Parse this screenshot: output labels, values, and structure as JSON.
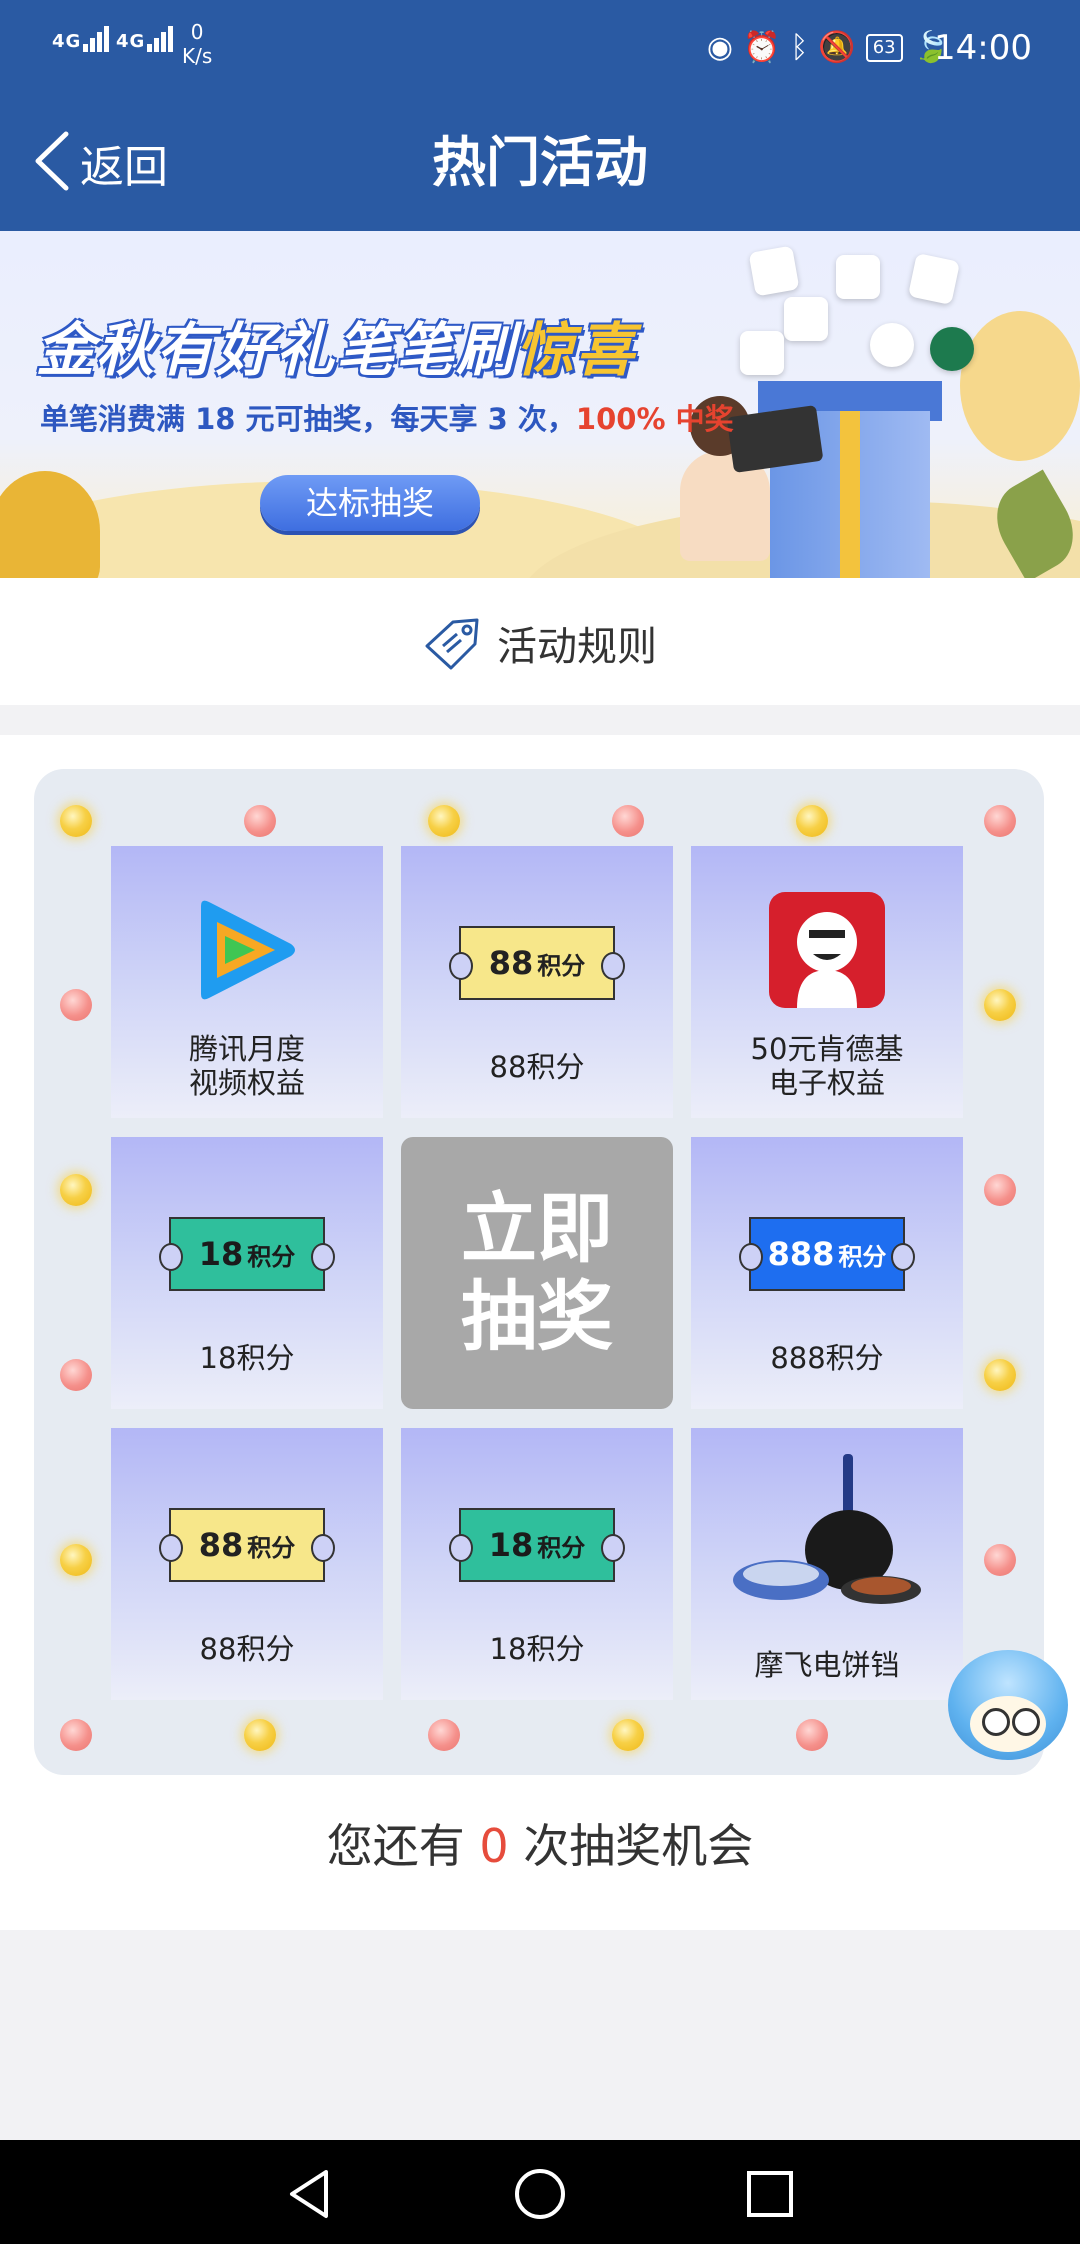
{
  "status_bar": {
    "sig1": "4G",
    "sig2": "4G",
    "net_speed": "0",
    "net_unit": "K/s",
    "battery": "63",
    "time": "14:00"
  },
  "nav": {
    "back_label": "返回",
    "title": "热门活动"
  },
  "banner": {
    "title_main": "金秋有好礼笔笔刷",
    "title_highlight": "惊喜",
    "subtitle_main": "单笔消费满 18 元可抽奖，每天享 3 次，",
    "subtitle_highlight": "100% 中奖",
    "button_label": "达标抽奖"
  },
  "rules": {
    "label": "活动规则"
  },
  "grid": {
    "cells": [
      {
        "label_line1": "腾讯月度",
        "label_line2": "视频权益"
      },
      {
        "ticket_num": "88",
        "ticket_unit": "积分",
        "label": "88积分"
      },
      {
        "label_line1": "50元肯德基",
        "label_line2": "电子权益"
      },
      {
        "ticket_num": "18",
        "ticket_unit": "积分",
        "label": "18积分"
      },
      {
        "ticket_num": "888",
        "ticket_unit": "积分",
        "label": "888积分"
      },
      {
        "ticket_num": "88",
        "ticket_unit": "积分",
        "label": "88积分"
      },
      {
        "ticket_num": "18",
        "ticket_unit": "积分",
        "label": "18积分"
      },
      {
        "label": "摩飞电饼铛"
      }
    ],
    "center_line1": "立即",
    "center_line2": "抽奖"
  },
  "chances": {
    "prefix": "您还有 ",
    "count": "0",
    "suffix": " 次抽奖机会"
  },
  "icons": [
    "back-chevron-icon",
    "eye-icon",
    "alarm-icon",
    "bluetooth-icon",
    "mute-icon",
    "leaf-icon",
    "tag-icon",
    "video-play-icon",
    "kfc-logo-icon",
    "pan-icon",
    "mascot-icon",
    "nav-back-icon",
    "nav-home-icon",
    "nav-recents-icon"
  ],
  "colors": {
    "header": "#2a5aa3",
    "accent_red": "#e64c3c",
    "center_button": "#a8a8a8"
  }
}
